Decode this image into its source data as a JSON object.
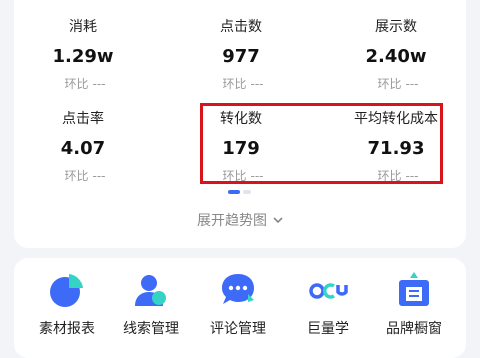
{
  "metrics": {
    "row1": [
      {
        "label": "消耗",
        "value": "1.29w",
        "cmp_label": "环比",
        "cmp_value": "---"
      },
      {
        "label": "点击数",
        "value": "977",
        "cmp_label": "环比",
        "cmp_value": "---"
      },
      {
        "label": "展示数",
        "value": "2.40w",
        "cmp_label": "环比",
        "cmp_value": "---"
      }
    ],
    "row2": [
      {
        "label": "点击率",
        "value": "4.07",
        "cmp_label": "环比",
        "cmp_value": "---"
      },
      {
        "label": "转化数",
        "value": "179",
        "cmp_label": "环比",
        "cmp_value": "---"
      },
      {
        "label": "平均转化成本",
        "value": "71.93",
        "cmp_label": "环比",
        "cmp_value": "---"
      }
    ]
  },
  "expand_label": "展开趋势图",
  "tools": [
    {
      "label": "素材报表",
      "icon": "pie-chart-icon"
    },
    {
      "label": "线索管理",
      "icon": "user-icon"
    },
    {
      "label": "评论管理",
      "icon": "chat-bubble-icon"
    },
    {
      "label": "巨量学",
      "icon": "oceanengine-logo-icon"
    },
    {
      "label": "品牌橱窗",
      "icon": "storefront-icon"
    }
  ],
  "colors": {
    "accent": "#3d6af7",
    "teal": "#35d3c6",
    "highlight": "#d8141a"
  }
}
